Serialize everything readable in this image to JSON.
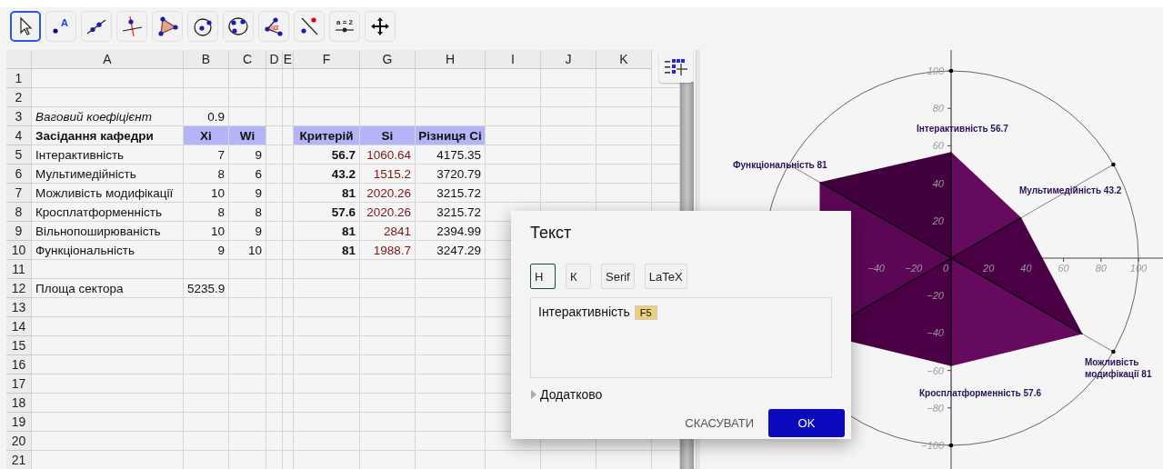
{
  "toolbar": {
    "tools": [
      {
        "kind": "move",
        "selected": true
      },
      {
        "kind": "point",
        "label": "A",
        "selected": false
      },
      {
        "kind": "line",
        "selected": false
      },
      {
        "kind": "perpendicular",
        "selected": false
      },
      {
        "kind": "polygon",
        "selected": false
      },
      {
        "kind": "circle",
        "selected": false
      },
      {
        "kind": "conic",
        "selected": false
      },
      {
        "kind": "angle",
        "label": "α",
        "selected": false
      },
      {
        "kind": "reflect",
        "selected": false
      },
      {
        "kind": "slider",
        "label": "a = 2",
        "selected": false
      },
      {
        "kind": "move-view",
        "selected": false
      }
    ]
  },
  "spreadsheet": {
    "columns": [
      "A",
      "B",
      "C",
      "D",
      "E",
      "F",
      "G",
      "H",
      "I",
      "J",
      "K"
    ],
    "rows": [
      {
        "number": "1"
      },
      {
        "number": "2"
      },
      {
        "number": "3",
        "cells": [
          {
            "text": "Ваговий коефіцієнт",
            "kind": "italic"
          },
          {
            "text": "0.9",
            "kind": "number"
          }
        ]
      },
      {
        "number": "4",
        "cells": [
          {
            "text": "Засідання кафедри",
            "kind": "bold"
          },
          {
            "text": "Xi",
            "kind": "header"
          },
          {
            "text": "Wi",
            "kind": "header"
          },
          null,
          null,
          {
            "text": "Критерій",
            "kind": "header"
          },
          {
            "text": "Si",
            "kind": "header"
          },
          {
            "text": "Різниця Ci",
            "kind": "header"
          }
        ]
      },
      {
        "number": "5",
        "cells": [
          {
            "text": "Інтерактивність",
            "kind": "label"
          },
          {
            "text": "7",
            "kind": "number"
          },
          {
            "text": "9",
            "kind": "number"
          },
          null,
          null,
          {
            "text": "56.7",
            "kind": "number-bold"
          },
          {
            "text": "1060.64",
            "kind": "number-red"
          },
          {
            "text": "4175.35",
            "kind": "number"
          }
        ]
      },
      {
        "number": "6",
        "cells": [
          {
            "text": "Мультимедійність",
            "kind": "label"
          },
          {
            "text": "8",
            "kind": "number"
          },
          {
            "text": "6",
            "kind": "number"
          },
          null,
          null,
          {
            "text": "43.2",
            "kind": "number-bold"
          },
          {
            "text": "1515.2",
            "kind": "number-red"
          },
          {
            "text": "3720.79",
            "kind": "number"
          }
        ]
      },
      {
        "number": "7",
        "cells": [
          {
            "text": "Можливість модифікації",
            "kind": "label"
          },
          {
            "text": "10",
            "kind": "number"
          },
          {
            "text": "9",
            "kind": "number"
          },
          null,
          null,
          {
            "text": "81",
            "kind": "number-bold"
          },
          {
            "text": "2020.26",
            "kind": "number-red"
          },
          {
            "text": "3215.72",
            "kind": "number"
          }
        ]
      },
      {
        "number": "8",
        "cells": [
          {
            "text": "Кросплатформенність",
            "kind": "label"
          },
          {
            "text": "8",
            "kind": "number"
          },
          {
            "text": "8",
            "kind": "number"
          },
          null,
          null,
          {
            "text": "57.6",
            "kind": "number-bold"
          },
          {
            "text": "2020.26",
            "kind": "number-red"
          },
          {
            "text": "3215.72",
            "kind": "number"
          }
        ]
      },
      {
        "number": "9",
        "cells": [
          {
            "text": "Вільнопоширюваність",
            "kind": "label"
          },
          {
            "text": "10",
            "kind": "number"
          },
          {
            "text": "9",
            "kind": "number"
          },
          null,
          null,
          {
            "text": "81",
            "kind": "number-bold"
          },
          {
            "text": "2841",
            "kind": "number-red"
          },
          {
            "text": "2394.99",
            "kind": "number"
          }
        ]
      },
      {
        "number": "10",
        "cells": [
          {
            "text": "Функціональність",
            "kind": "label"
          },
          {
            "text": "9",
            "kind": "number"
          },
          {
            "text": "10",
            "kind": "number"
          },
          null,
          null,
          {
            "text": "81",
            "kind": "number-bold"
          },
          {
            "text": "1988.7",
            "kind": "number-red"
          },
          {
            "text": "3247.29",
            "kind": "number"
          }
        ]
      },
      {
        "number": "11"
      },
      {
        "number": "12",
        "cells": [
          {
            "text": "Площа сектора",
            "kind": "label"
          },
          {
            "text": "5235.9",
            "kind": "overflow"
          }
        ]
      },
      {
        "number": "13"
      },
      {
        "number": "14"
      },
      {
        "number": "15"
      },
      {
        "number": "16"
      },
      {
        "number": "17"
      },
      {
        "number": "18"
      },
      {
        "number": "19"
      },
      {
        "number": "20"
      },
      {
        "number": "21"
      }
    ]
  },
  "graphics": {
    "x_ticks": [
      "−40",
      "−20",
      "0",
      "20",
      "40",
      "60",
      "80",
      "100"
    ],
    "y_ticks": [
      "100",
      "80",
      "60",
      "40",
      "20",
      "−20",
      "−40",
      "−60",
      "−80",
      "−100"
    ],
    "point_labels": [
      {
        "lines": [
          "Інтерактивність 56.7"
        ]
      },
      {
        "lines": [
          "Функціональність  81"
        ]
      },
      {
        "lines": [
          "Мультимедійність 43.2"
        ]
      },
      {
        "lines": [
          "Можливість",
          "модифікації  81"
        ]
      },
      {
        "lines": [
          "Кросплатформенність  57.6"
        ]
      }
    ]
  },
  "dialog": {
    "title": "Текст",
    "format_buttons": [
      {
        "label": "Н",
        "selected": true
      },
      {
        "label": "К",
        "selected": false
      },
      {
        "label": "Serif",
        "selected": false
      },
      {
        "label": "LaTeX",
        "selected": false
      }
    ],
    "editor": {
      "text": "Інтерактивність",
      "chip": "F5"
    },
    "advanced": {
      "label": "Додатково",
      "expanded": false
    },
    "buttons": [
      {
        "label": "СКАСУВАТИ",
        "kind": "text"
      },
      {
        "label": "OK",
        "kind": "primary"
      }
    ]
  }
}
